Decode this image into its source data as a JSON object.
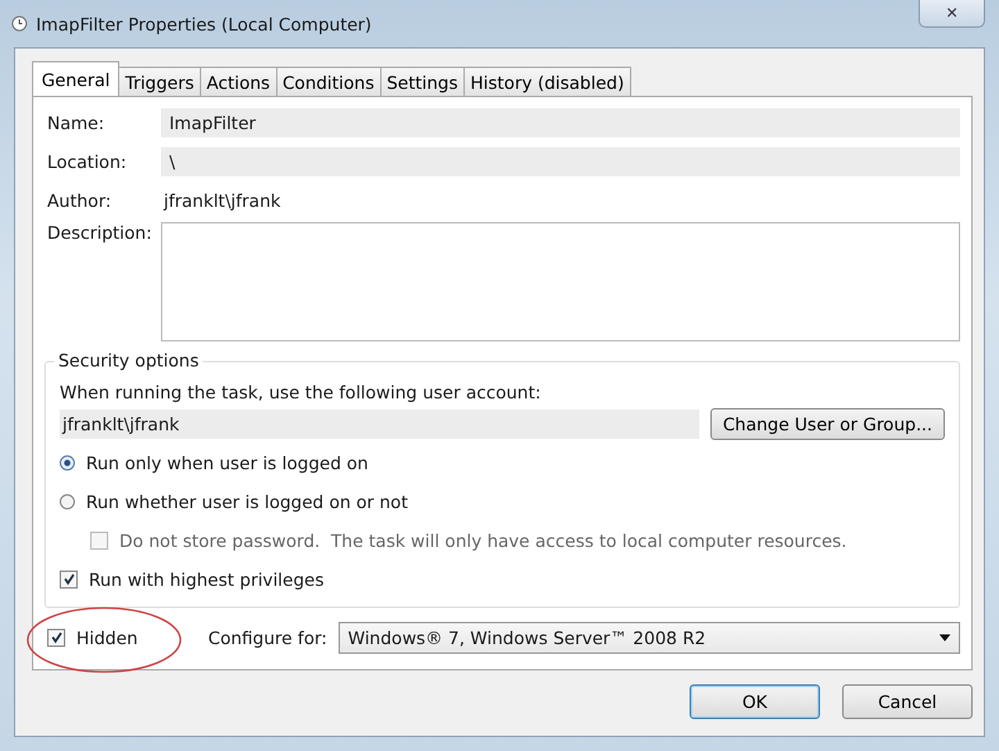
{
  "window": {
    "title": "ImapFilter Properties (Local Computer)",
    "close": "✕"
  },
  "tabs": [
    {
      "label": "General",
      "selected": true
    },
    {
      "label": "Triggers",
      "selected": false
    },
    {
      "label": "Actions",
      "selected": false
    },
    {
      "label": "Conditions",
      "selected": false
    },
    {
      "label": "Settings",
      "selected": false
    },
    {
      "label": "History (disabled)",
      "selected": false
    }
  ],
  "fields": [
    {
      "label": "Name:",
      "value": "ImapFilter",
      "kind": "readonly"
    },
    {
      "label": "Location:",
      "value": "\\",
      "kind": "readonly"
    },
    {
      "label": "Author:",
      "value": "jfranklt\\jfrank",
      "kind": "plain"
    },
    {
      "label": "Description:",
      "kind": "multiline"
    }
  ],
  "security": {
    "title": "Security options",
    "prompt": "When running the task, use the following user account:",
    "account": "jfranklt\\jfrank",
    "change_button": "Change User or Group...",
    "options": [
      {
        "kind": "radio",
        "label": "Run only when user is logged on",
        "selected": true
      },
      {
        "kind": "radio",
        "label": "Run whether user is logged on or not",
        "selected": false
      },
      {
        "kind": "checkbox",
        "label": "Do not store password.  The task will only have access to local computer resources.",
        "checked": false,
        "disabled": true,
        "nested": true
      },
      {
        "kind": "checkbox",
        "label": "Run with highest privileges",
        "checked": true,
        "disabled": false
      }
    ]
  },
  "hidden": {
    "label": "Hidden",
    "checked": true,
    "circled": true
  },
  "configure": {
    "label": "Configure for:",
    "value": "Windows® 7, Windows Server™ 2008 R2"
  },
  "buttons": [
    "OK",
    "Cancel"
  ]
}
